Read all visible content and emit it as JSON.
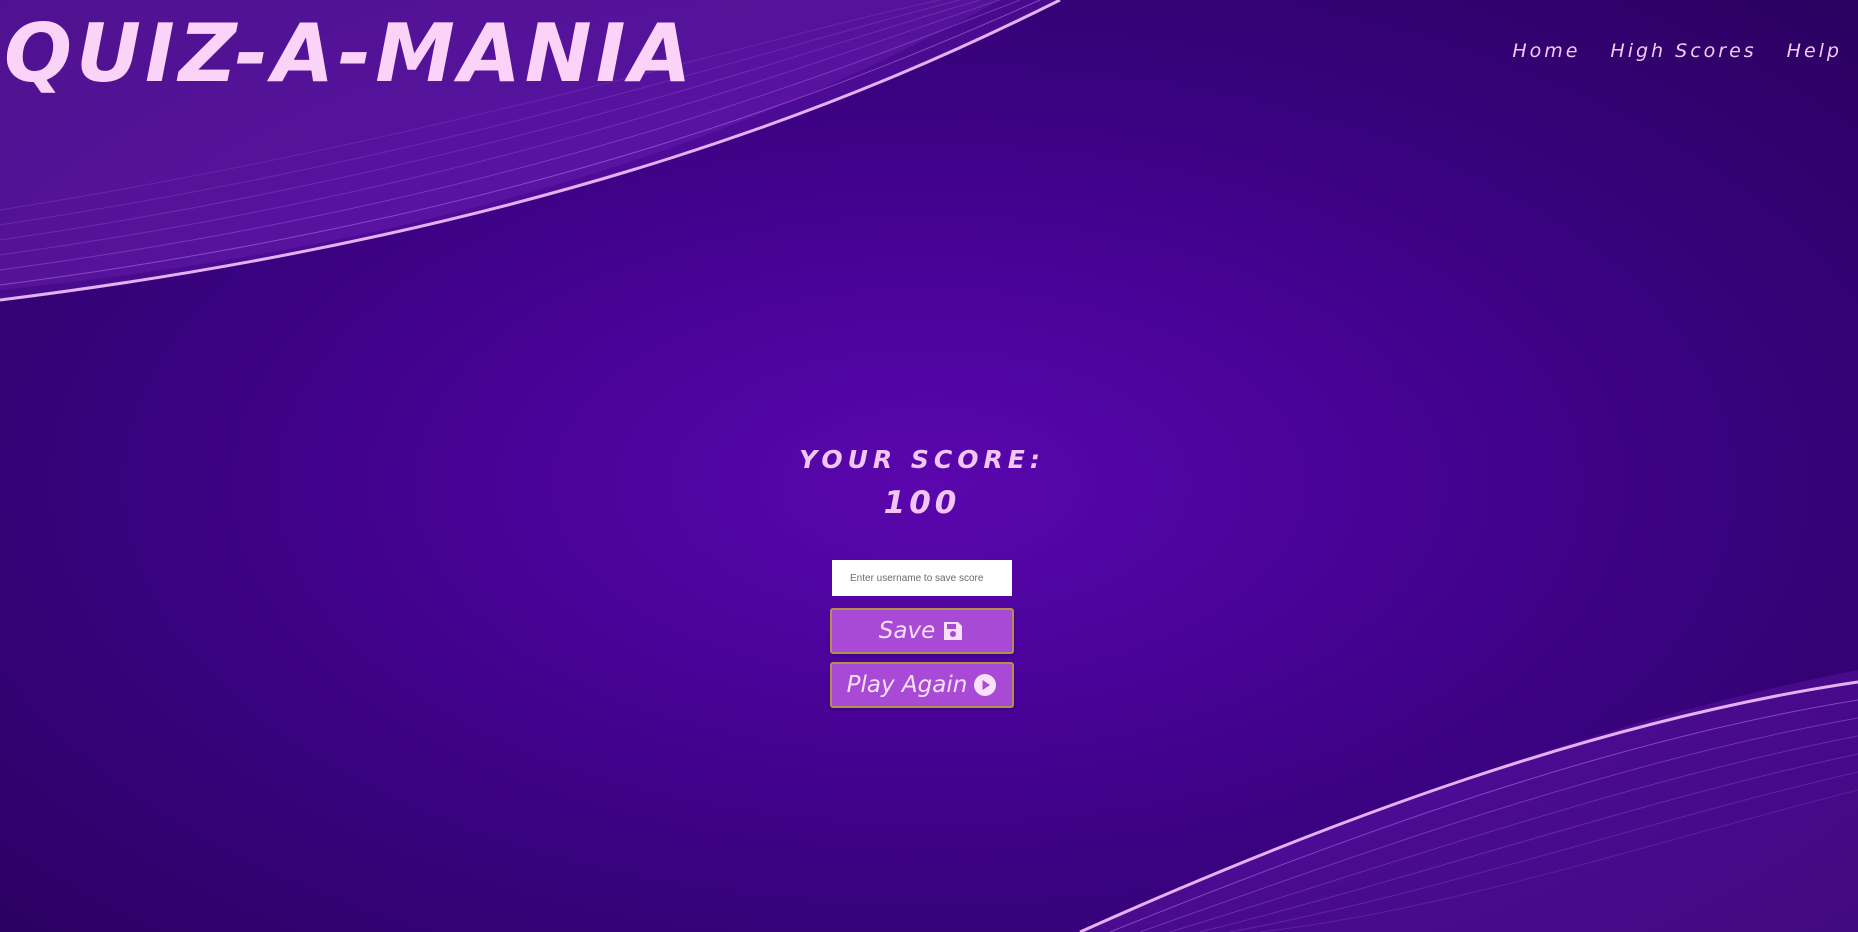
{
  "brand": {
    "title": "QUIZ-A-MANIA"
  },
  "nav": {
    "items": [
      {
        "label": "Home"
      },
      {
        "label": "High Scores"
      },
      {
        "label": "Help"
      }
    ]
  },
  "score": {
    "label": "YOUR SCORE:",
    "value": "100"
  },
  "form": {
    "username_placeholder": "Enter username to save score",
    "username_value": "",
    "save_label": "Save",
    "save_icon": "floppy-disk-icon",
    "play_again_label": "Play Again",
    "play_again_icon": "play-circle-icon"
  },
  "colors": {
    "background": "#4a0399",
    "accent_text": "#f2c6f4",
    "button_bg": "#a94ad6",
    "button_border": "#b4914a"
  }
}
